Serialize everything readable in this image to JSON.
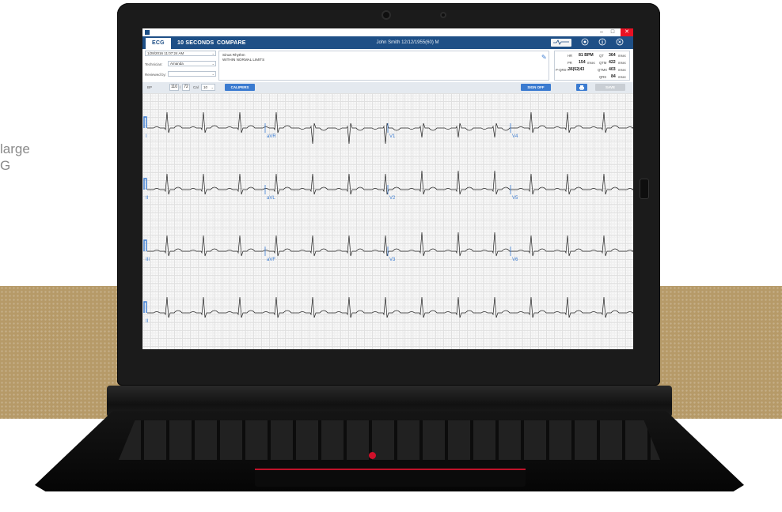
{
  "side_text": [
    "large",
    "G"
  ],
  "window": {
    "minimize": "–",
    "maximize": "□",
    "close": "✕"
  },
  "tabs": [
    {
      "label": "ECG",
      "active": true
    },
    {
      "label": "10 SECONDS",
      "active": false
    },
    {
      "label": "COMPARE",
      "active": false
    }
  ],
  "patient": "John Smith   12/12/1955(60)   M",
  "toolbar_icons": [
    "settings-icon",
    "info-icon",
    "exit-icon"
  ],
  "info": {
    "datetime": "1/28/2016 11:07:24 AM",
    "technician_label": "Technician:",
    "technician": "Amanda",
    "reviewed_label": "Reviewed by:",
    "reviewed": "",
    "interpretation": [
      "Sinus Rhythm",
      "WITHIN NORMAL LIMITS"
    ]
  },
  "measurements": {
    "hr_label": "HR",
    "hr_value": "81 BPM",
    "qt_label": "QT",
    "qt_value": "364",
    "qt_unit": "msec",
    "pr_label": "PR",
    "pr_value": "154",
    "pr_unit": "msec",
    "qtm_label": "QTM",
    "qtm_value": "422",
    "qtm_unit": "msec",
    "prst_label": "P-QRS-T",
    "prst_value": "36|52|43",
    "qtmx_label": "QTMX",
    "qtmx_value": "403",
    "qtmx_unit": "msec",
    "qrs_label": "QRS",
    "qrs_value": "84",
    "qrs_unit": "msec"
  },
  "controls": {
    "bp_label": "BP",
    "bp_sys": "110",
    "bp_sep": "/",
    "bp_dia": "72",
    "cal_label": "Cal",
    "cal_value": "10",
    "calipers": "CALIPERS",
    "sign_off": "SIGN OFF",
    "save": "SAVE"
  },
  "ecg": {
    "rows": [
      {
        "leads": [
          "I",
          "aVR",
          "V1",
          "V4"
        ]
      },
      {
        "leads": [
          "II",
          "aVL",
          "V2",
          "V5"
        ]
      },
      {
        "leads": [
          "III",
          "aVF",
          "V3",
          "V6"
        ]
      },
      {
        "leads": [
          "II"
        ]
      }
    ]
  },
  "colors": {
    "header_blue": "#1e4f86",
    "accent_blue": "#3b7bd0",
    "close_red": "#e81123",
    "band_tan": "#b69a68"
  }
}
